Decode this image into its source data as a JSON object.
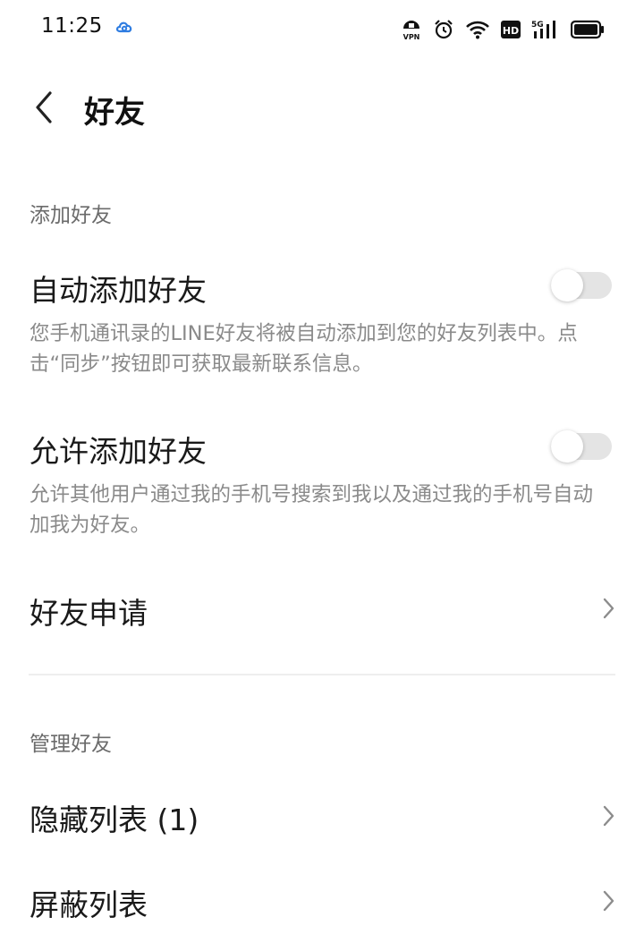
{
  "status_bar": {
    "time": "11:25",
    "icons": [
      "cloud-sync-icon",
      "vpn-icon",
      "alarm-icon",
      "wifi-icon",
      "hd-icon",
      "signal-5g-icon",
      "battery-icon"
    ]
  },
  "header": {
    "back_icon": "chevron-left-icon",
    "title": "好友"
  },
  "sections": {
    "add_friends": {
      "label": "添加好友",
      "auto_add": {
        "title": "自动添加好友",
        "description": "您手机通讯录的LINE好友将被自动添加到您的好友列表中。点击“同步”按钮即可获取最新联系信息。",
        "enabled": false
      },
      "allow_add": {
        "title": "允许添加好友",
        "description": "允许其他用户通过我的手机号搜索到我以及通过我的手机号自动加我为好友。",
        "enabled": false
      },
      "friend_requests": {
        "title": "好友申请"
      }
    },
    "manage_friends": {
      "label": "管理好友",
      "hidden_list": {
        "title": "隐藏列表 (1)"
      },
      "blocked_list": {
        "title": "屏蔽列表"
      }
    }
  },
  "colors": {
    "toggle_off_track": "#e4e4e4",
    "secondary_text": "#8a8a8a",
    "section_label": "#6b6b6b",
    "divider": "#eeeeee"
  }
}
